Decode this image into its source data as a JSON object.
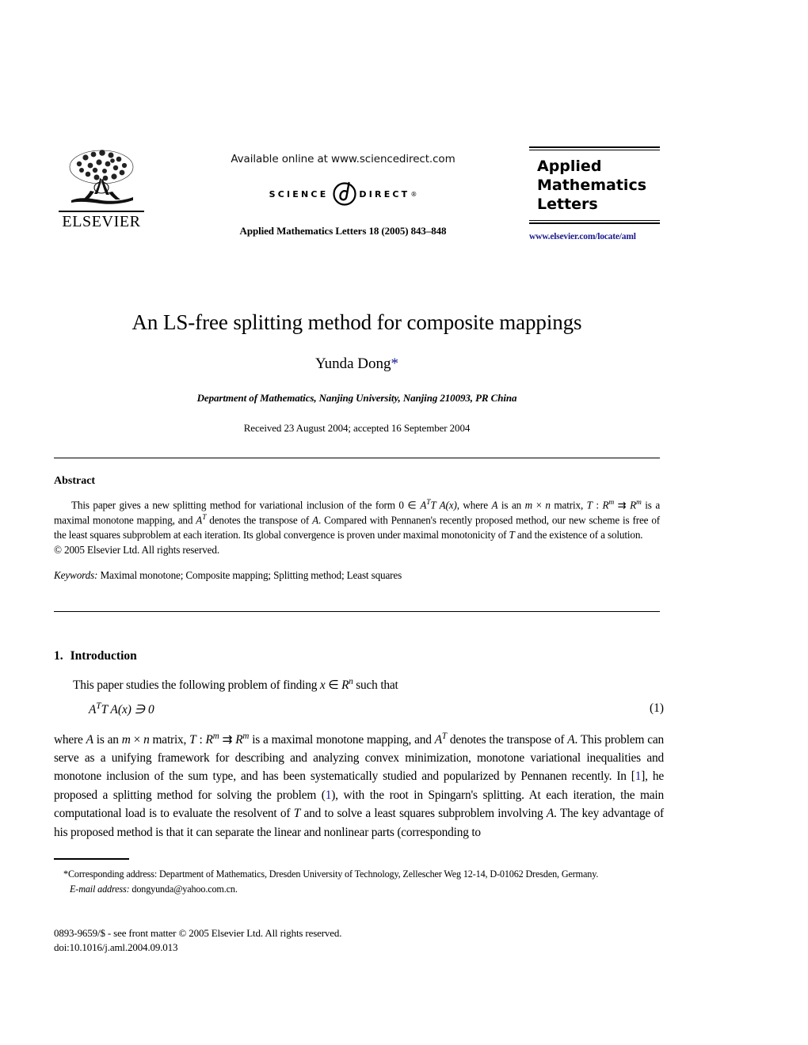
{
  "masthead": {
    "publisher_name": "ELSEVIER",
    "publisher_logo_alt": "elsevier-tree-logo",
    "available_online": "Available online at www.sciencedirect.com",
    "sciencedirect_word_1": "SCIENCE",
    "sciencedirect_word_2": "DIRECT",
    "sciencedirect_registered": "®",
    "journal_citation": "Applied Mathematics Letters 18 (2005) 843–848",
    "journal_title_line1": "Applied",
    "journal_title_line2": "Mathematics",
    "journal_title_line3": "Letters",
    "journal_url": "www.elsevier.com/locate/aml",
    "url_color": "#1a1a8c"
  },
  "title_block": {
    "title": "An LS-free splitting method for composite mappings",
    "author": "Yunda Dong",
    "author_marker": "*",
    "affiliation": "Department of Mathematics, Nanjing University, Nanjing 210093, PR China",
    "dates": "Received 23 August 2004; accepted 16 September 2004"
  },
  "abstract": {
    "heading": "Abstract",
    "text_1": "This paper gives a new splitting method for variational inclusion of the form 0 ",
    "in_symbol": "∈",
    "text_2": " ",
    "math_ATTA": "A",
    "math_sup_T": "T",
    "math_TA": "T A(x)",
    "text_3": ", where ",
    "math_A": "A",
    "text_4": " is an ",
    "math_m": "m",
    "times": " × ",
    "math_n": "n",
    "text_5": " matrix, ",
    "math_T": "T",
    "text_6": " : ",
    "math_Rm1": "R",
    "sup_m1": "m",
    "arrow": " ⇉ ",
    "math_Rm2": "R",
    "sup_m2": "m",
    "text_7": " is a maximal monotone mapping, and ",
    "math_AT_A": "A",
    "sup_AT_T": "T",
    "text_8": " denotes the transpose of ",
    "math_A2": "A",
    "text_9": ". Compared with Pennanen's recently proposed method, our new scheme is free of the least squares subproblem at each iteration. Its global convergence is proven under maximal monotonicity of ",
    "math_T2": "T",
    "text_10": " and the existence of a solution.",
    "copyright": "© 2005 Elsevier Ltd. All rights reserved.",
    "keywords_label": "Keywords:",
    "keywords_value": " Maximal monotone; Composite mapping; Splitting method; Least squares"
  },
  "introduction": {
    "number": "1.",
    "heading": "Introduction",
    "para1_text1": "This paper studies the following problem of finding ",
    "para1_x": "x",
    "para1_in": " ∈ ",
    "para1_R": "R",
    "para1_sup_n": "n",
    "para1_text2": " such that",
    "equation_A": "A",
    "equation_sup_T": "T",
    "equation_rest": "T A(x) ∋ 0",
    "equation_number": "(1)",
    "para2_t1": "where ",
    "para2_A": "A",
    "para2_t2": " is an ",
    "para2_m": "m",
    "para2_times": " × ",
    "para2_n": "n",
    "para2_t3": " matrix, ",
    "para2_T": "T",
    "para2_t4": " : ",
    "para2_R1": "R",
    "para2_sup_m1": "m",
    "para2_arrow": " ⇉ ",
    "para2_R2": "R",
    "para2_sup_m2": "m",
    "para2_t5": " is a maximal monotone mapping, and ",
    "para2_AT": "A",
    "para2_sup_T2": "T",
    "para2_t6": " denotes the transpose of ",
    "para2_A2": "A",
    "para2_t7": ". This problem can serve as a unifying framework for describing and analyzing convex minimization, monotone variational inequalities and monotone inclusion of the sum type, and has been systematically studied and popularized by Pennanen recently. In [",
    "para2_ref1": "1",
    "para2_t8": "], he proposed a splitting method for solving the problem (",
    "para2_ref2": "1",
    "para2_t9": "), with the root in Spingarn's splitting. At each iteration, the main computational load is to evaluate the resolvent of ",
    "para2_T2": "T",
    "para2_t10": " and to solve a least squares subproblem involving ",
    "para2_A3": "A",
    "para2_t11": ". The key advantage of his proposed method is that it can separate the linear and nonlinear parts (corresponding to",
    "link_color": "#1a1a8c"
  },
  "footnote": {
    "marker": "*",
    "line1": "Corresponding address: Department of Mathematics, Dresden University of Technology, Zellescher Weg 12-14, D-01062 Dresden, Germany.",
    "email_label": "E-mail address:",
    "email_value": " dongyunda@yahoo.com.cn."
  },
  "colophon": {
    "line1": "0893-9659/$ - see front matter © 2005 Elsevier Ltd. All rights reserved.",
    "line2": "doi:10.1016/j.aml.2004.09.013"
  }
}
